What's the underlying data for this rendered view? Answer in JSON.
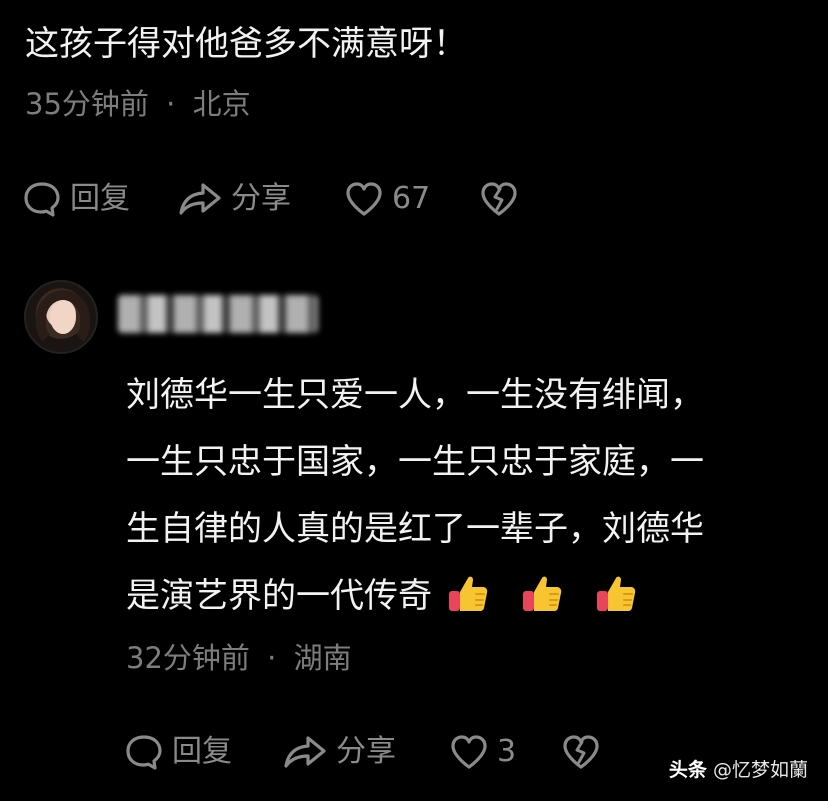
{
  "comment_1": {
    "text": "这孩子得对他爸多不满意呀！",
    "time": "35分钟前",
    "separator": "·",
    "location": "北京",
    "actions": {
      "reply_label": "回复",
      "share_label": "分享",
      "like_count": "67"
    }
  },
  "comment_2": {
    "lines": [
      "刘德华一生只爱一人，一生没有绯闻，",
      "一生只忠于国家，一生只忠于家庭，一",
      "生自律的人真的是红了一辈子，刘德华",
      "是演艺界的一代传奇"
    ],
    "emojis": [
      "thumbs-up",
      "thumbs-up",
      "thumbs-up"
    ],
    "time": "32分钟前",
    "separator": "·",
    "location": "湖南",
    "actions": {
      "reply_label": "回复",
      "share_label": "分享",
      "like_count": "3"
    }
  },
  "watermark": {
    "brand": "头条",
    "handle": "@忆梦如蘭"
  },
  "colors": {
    "background": "#000000",
    "text": "#f2f2f2",
    "meta": "#7d7d7d",
    "action": "#8a8a8a",
    "thumb_yellow": "#f7c531",
    "thumb_red": "#e8455a"
  }
}
